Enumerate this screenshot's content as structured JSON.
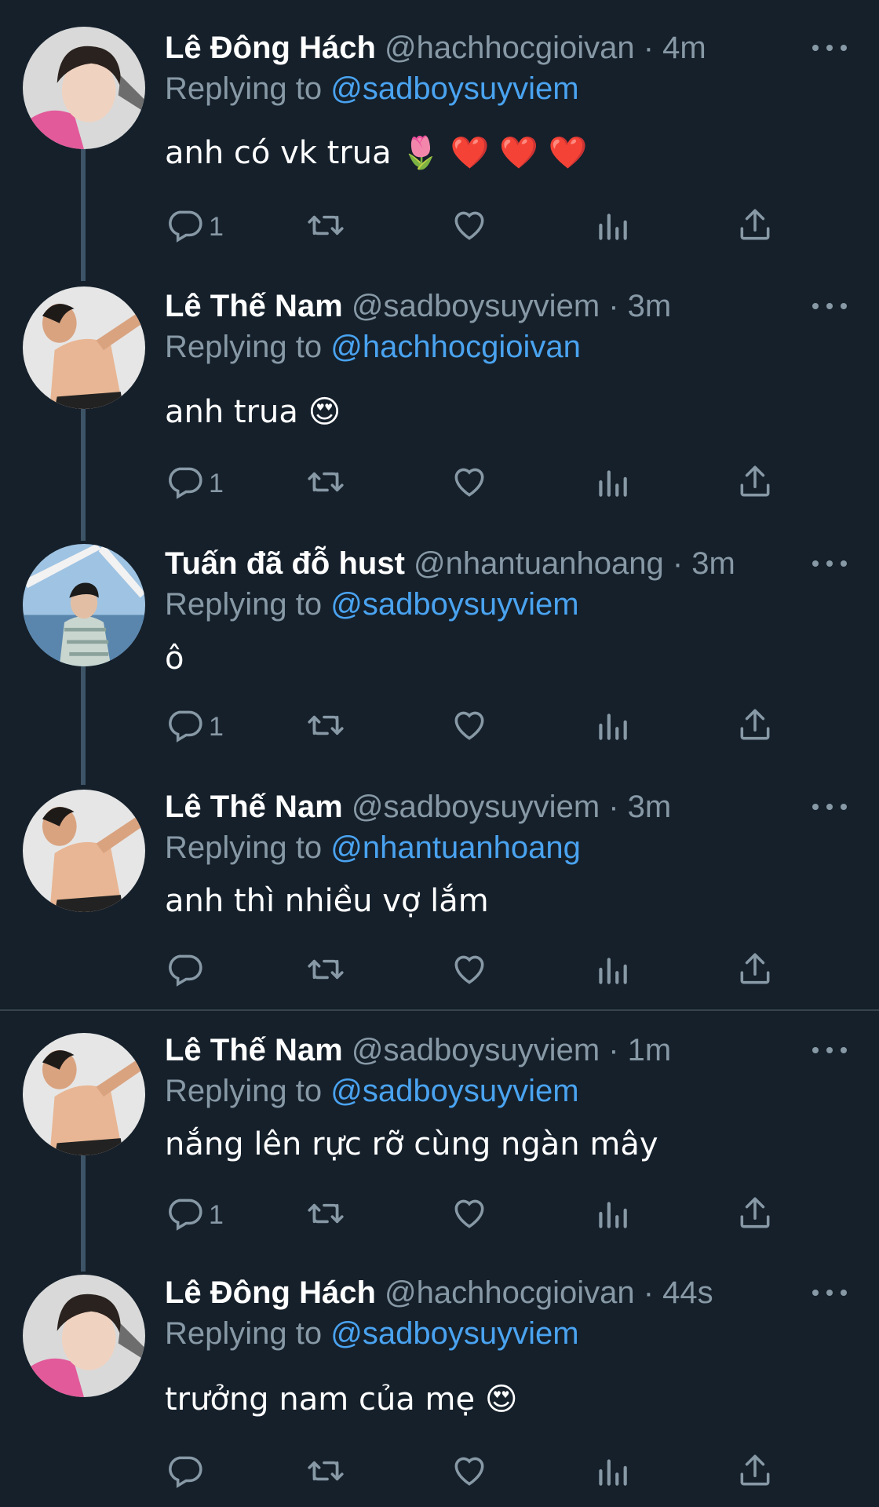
{
  "tweets": [
    {
      "name": "Lê Đông Hách",
      "handle": "@hachhocgioivan · 4m",
      "replying_prefix": "Replying to ",
      "replying_to": "@sadboysuyviem",
      "text": "anh có vk trua 🌷 ❤️ ❤️ ❤️",
      "reply_count": "1",
      "avatar": "avatar-pink-hoodie"
    },
    {
      "name": "Lê Thế Nam",
      "handle": "@sadboysuyviem · 3m",
      "replying_prefix": "Replying to ",
      "replying_to": "@hachhocgioivan",
      "text": "anh trua 😍",
      "reply_count": "1",
      "avatar": "avatar-shirtless"
    },
    {
      "name": "Tuấn đã đỗ hust",
      "handle": "@nhantuanhoang · 3m",
      "replying_prefix": "Replying to ",
      "replying_to": "@sadboysuyviem",
      "text": "ô",
      "reply_count": "1",
      "avatar": "avatar-boat"
    },
    {
      "name": "Lê Thế Nam",
      "handle": "@sadboysuyviem · 3m",
      "replying_prefix": "Replying to ",
      "replying_to": "@nhantuanhoang",
      "text": "anh thì nhiều vợ lắm",
      "reply_count": "",
      "avatar": "avatar-shirtless"
    },
    {
      "name": "Lê Thế Nam",
      "handle": "@sadboysuyviem · 1m",
      "replying_prefix": "Replying to ",
      "replying_to": "@sadboysuyviem",
      "text": "nắng lên rực rỡ cùng ngàn mây",
      "reply_count": "1",
      "avatar": "avatar-shirtless"
    },
    {
      "name": "Lê Đông Hách",
      "handle": "@hachhocgioivan · 44s",
      "replying_prefix": "Replying to ",
      "replying_to": "@sadboysuyviem",
      "text": "trưởng nam của mẹ 😍",
      "reply_count": "",
      "avatar": "avatar-pink-hoodie"
    }
  ],
  "colors": {
    "background": "#15202b",
    "secondary_text": "#8899a6",
    "link": "#4aa3f0",
    "thread_line": "#3d5466"
  }
}
